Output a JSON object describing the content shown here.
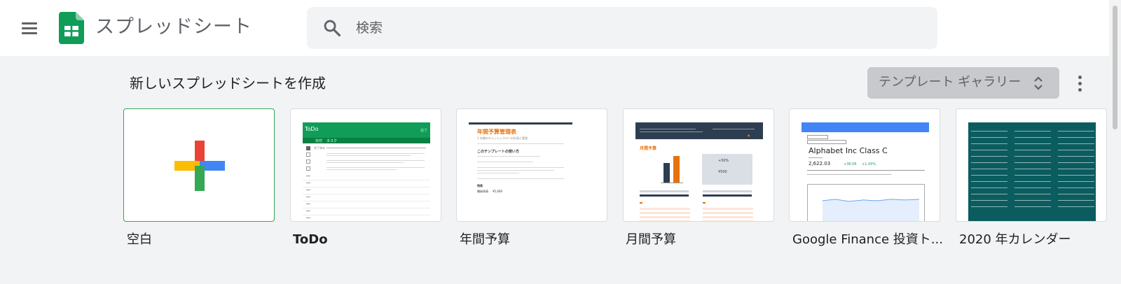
{
  "header": {
    "app_title": "スプレッドシート",
    "search_placeholder": "検索",
    "icons": [
      "menu-icon",
      "sheets-logo-icon",
      "search-icon"
    ]
  },
  "section": {
    "title": "新しいスプレッドシートを作成",
    "gallery_button_label": "テンプレート ギャラリー",
    "icons": [
      "unfold-icon",
      "more-vert-icon"
    ]
  },
  "templates": [
    {
      "label": "空白"
    },
    {
      "label": "ToDo",
      "preview": {
        "header": "ToDo",
        "header_right": "完了",
        "col1": "日付",
        "col2": "タスク",
        "date_text": "完了済み"
      }
    },
    {
      "label": "年間予算",
      "preview": {
        "title": "年間予算管理表",
        "subtitle": "1 年間のキャッシュフローの計画と管理",
        "section": "このテンプレートの使い方",
        "label_a": "残高",
        "label_b": "開始残高",
        "value_b": "¥5,000"
      }
    },
    {
      "label": "月間予算",
      "preview": {
        "title": "月間予算",
        "pct": "+50%",
        "amount": "¥500"
      }
    },
    {
      "label": "Google Finance 投資ト...",
      "preview": {
        "company": "Alphabet Inc Class C",
        "price": "2,622.03",
        "change": "+36.06",
        "change_pct": "+1.43%"
      }
    },
    {
      "label": "2020 年カレンダー"
    }
  ],
  "colors": {
    "sheets_green": "#0f9d58",
    "plus_red": "#ea4335",
    "plus_blue": "#4285f4",
    "plus_yellow": "#fbbc04",
    "plus_green": "#34a853",
    "budget_orange": "#e8710a",
    "budget_navy": "#2d3e50",
    "calendar_teal": "#0b5c5f"
  }
}
